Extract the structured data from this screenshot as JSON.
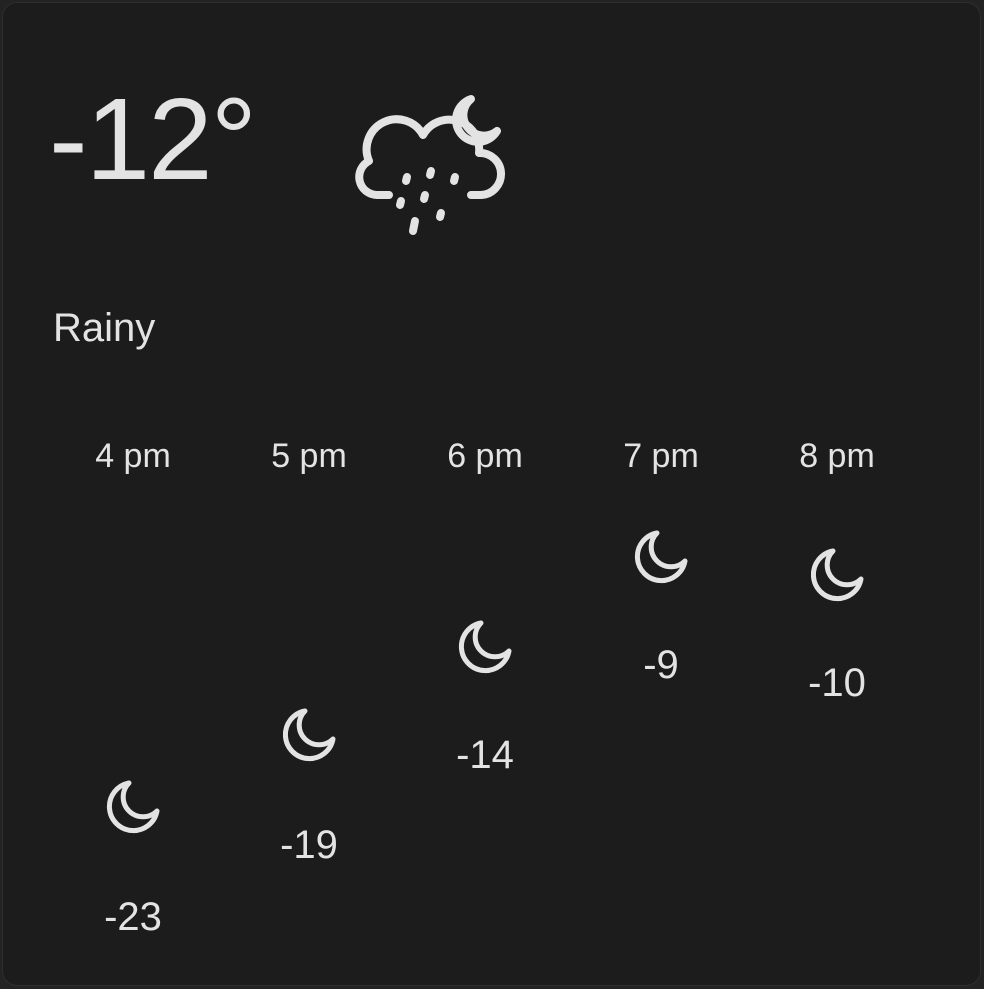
{
  "current": {
    "temperature": "-12°",
    "condition": "Rainy",
    "icon": "rain-night-icon"
  },
  "hourly": [
    {
      "time": "4 pm",
      "temp": "-23",
      "icon": "moon-icon"
    },
    {
      "time": "5 pm",
      "temp": "-19",
      "icon": "moon-icon"
    },
    {
      "time": "6 pm",
      "temp": "-14",
      "icon": "moon-icon"
    },
    {
      "time": "7 pm",
      "temp": "-9",
      "icon": "moon-icon"
    },
    {
      "time": "8 pm",
      "temp": "-10",
      "icon": "moon-icon"
    }
  ],
  "colors": {
    "background": "#1c1c1c",
    "foreground": "#e3e3e3"
  }
}
